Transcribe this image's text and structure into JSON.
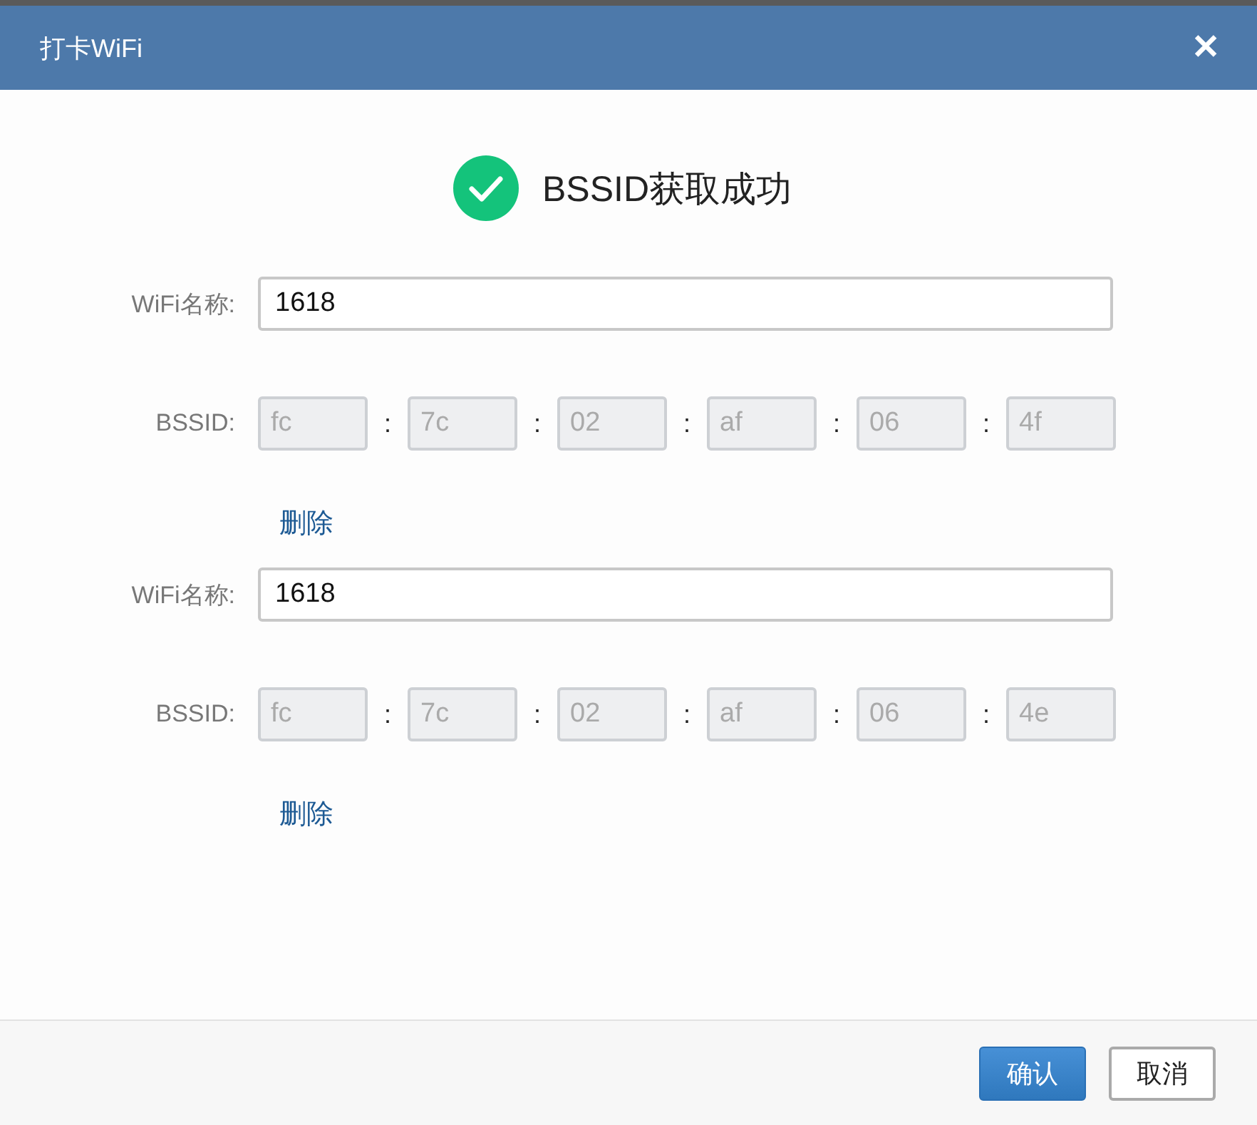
{
  "dialog": {
    "title": "打卡WiFi",
    "close": "✕"
  },
  "status": {
    "kind": "success",
    "message": "BSSID获取成功"
  },
  "entries": [
    {
      "wifi_label": "WiFi名称:",
      "wifi_name": "1618",
      "bssid_label": "BSSID:",
      "separator": ":",
      "bssid": [
        {
          "value": "fc",
          "disabled": true
        },
        {
          "value": "7c",
          "disabled": true
        },
        {
          "value": "02",
          "disabled": true
        },
        {
          "value": "af",
          "disabled": true
        },
        {
          "value": "06",
          "disabled": true
        },
        {
          "value": "4f",
          "disabled": true
        }
      ],
      "delete": "删除"
    },
    {
      "wifi_label": "WiFi名称:",
      "wifi_name": "1618",
      "bssid_label": "BSSID:",
      "separator": ":",
      "bssid": [
        {
          "value": "fc",
          "disabled": true
        },
        {
          "value": "7c",
          "disabled": true
        },
        {
          "value": "02",
          "disabled": true
        },
        {
          "value": "af",
          "disabled": true
        },
        {
          "value": "06",
          "disabled": true
        },
        {
          "value": "4e",
          "disabled": true
        }
      ],
      "delete": "删除"
    }
  ],
  "buttons": [
    {
      "label": "确认",
      "kind": "primary"
    },
    {
      "label": "取消",
      "kind": "secondary"
    }
  ]
}
